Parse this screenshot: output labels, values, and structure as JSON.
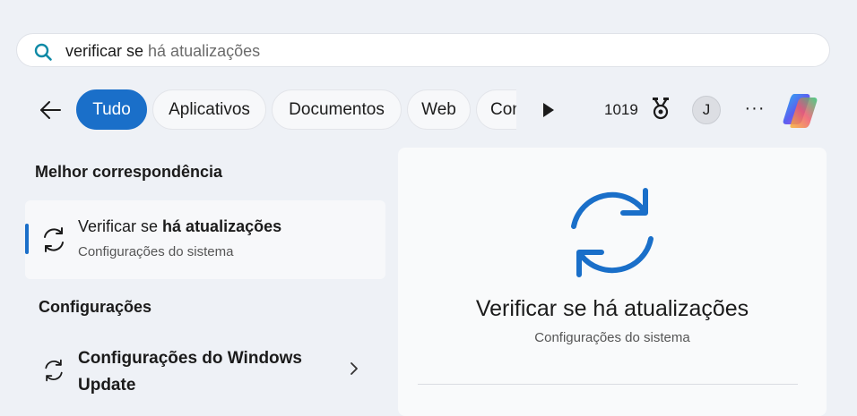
{
  "search": {
    "typed": "verificar se",
    "suggestion": " há atualizações",
    "icon": "search-icon"
  },
  "nav": {
    "back_icon": "back-arrow-icon",
    "tabs": [
      {
        "label": "Tudo",
        "active": true
      },
      {
        "label": "Aplicativos",
        "active": false
      },
      {
        "label": "Documentos",
        "active": false
      },
      {
        "label": "Web",
        "active": false
      },
      {
        "label": "Configurações",
        "active": false
      }
    ],
    "play_icon": "play-icon",
    "points": "1019",
    "rewards_icon": "rewards-medal-icon",
    "avatar_initial": "J",
    "more_label": "···",
    "copilot_icon": "copilot-icon"
  },
  "colors": {
    "accent": "#1a6fc9",
    "background": "#eef1f6",
    "panel": "#f9fafb"
  },
  "best_match": {
    "heading": "Melhor correspondência",
    "title_prefix": "Verificar se ",
    "title_bold": "há atualizações",
    "subtitle": "Configurações do sistema",
    "icon": "sync-icon"
  },
  "settings_section": {
    "heading": "Configurações",
    "items": [
      {
        "title": "Configurações do Windows Update",
        "icon": "sync-icon",
        "chevron": "chevron-right-icon"
      }
    ]
  },
  "preview": {
    "title": "Verificar se há atualizações",
    "subtitle": "Configurações do sistema",
    "icon": "sync-icon"
  }
}
